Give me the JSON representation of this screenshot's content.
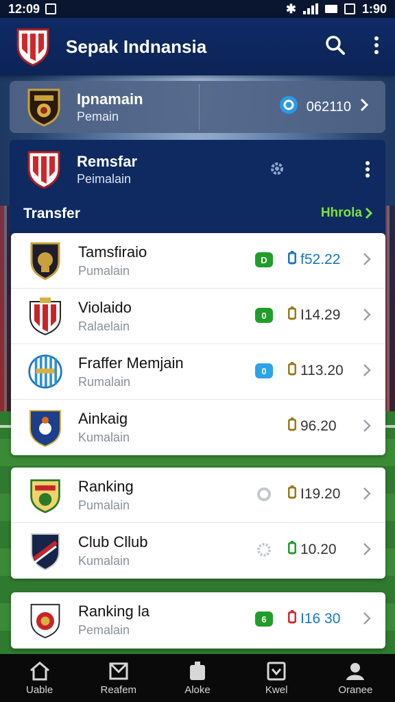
{
  "status_bar": {
    "time": "12:09",
    "right_time": "1:90"
  },
  "app_bar": {
    "title": "Sepak Indnansia"
  },
  "top_card": {
    "name": "Ipnamain",
    "sub": "Pemain",
    "value": "062110"
  },
  "panel": {
    "name": "Remsfar",
    "sub": "Peimalain",
    "section_title": "Transfer",
    "link": "Hhrola"
  },
  "list1": [
    {
      "name": "Tamsfiraio",
      "sub": "Pumalain",
      "badge": "D",
      "badge_color": "#1f9e2a",
      "value": "f52.22",
      "value_color": "#1a73c9",
      "icon_color": "#1a73c9"
    },
    {
      "name": "Violaido",
      "sub": "Ralaelain",
      "badge": "0",
      "badge_color": "#1f9e2a",
      "value": "I14.29",
      "value_color": "#333333",
      "icon_color": "#9a7a1a"
    },
    {
      "name": "Fraffer Memjain",
      "sub": "Rumalain",
      "badge": "0",
      "badge_color": "#2aa3e8",
      "value": "113.20",
      "value_color": "#333333",
      "icon_color": "#9a7a1a"
    },
    {
      "name": "Ainkaig",
      "sub": "Kumalain",
      "badge": "",
      "badge_color": "",
      "value": "96.20",
      "value_color": "#333333",
      "icon_color": "#9a7a1a"
    }
  ],
  "list2": [
    {
      "name": "Ranking",
      "sub": "Pumalain",
      "value": "I19.20",
      "value_color": "#333333",
      "icon_color": "#9a7a1a"
    },
    {
      "name": "Club Cllub",
      "sub": "Kumalain",
      "value": "10.20",
      "value_color": "#333333",
      "icon_color": "#1f9e2a"
    }
  ],
  "list3": [
    {
      "name": "Ranking la",
      "sub": "Pemalain",
      "badge": "6",
      "badge_color": "#1f9e2a",
      "value": "I16 30",
      "value_color": "#1a73c9",
      "icon_color": "#d02a2a"
    }
  ],
  "bottom_nav": [
    {
      "label": "Uable",
      "icon": "home-icon"
    },
    {
      "label": "Reafem",
      "icon": "stadium-icon"
    },
    {
      "label": "Aloke",
      "icon": "clipboard-icon"
    },
    {
      "label": "Kwel",
      "icon": "chart-icon"
    },
    {
      "label": "Oranee",
      "icon": "person-icon"
    }
  ]
}
